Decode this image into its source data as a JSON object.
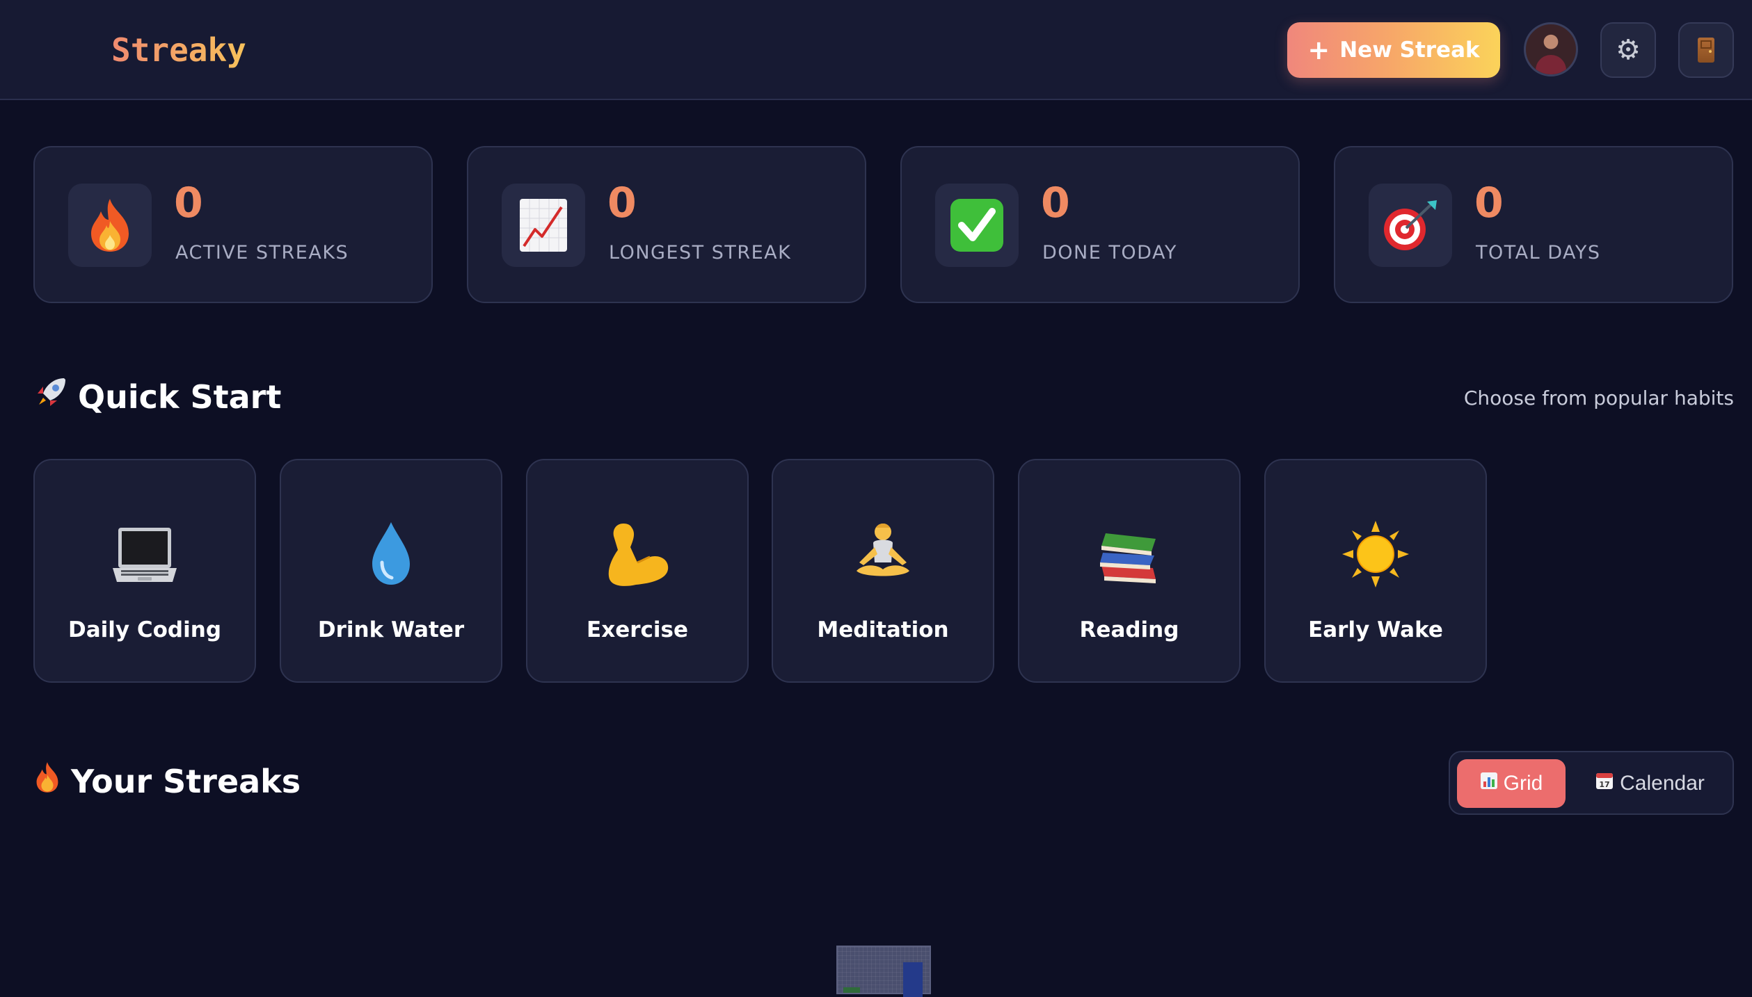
{
  "header": {
    "logo": "Streaky",
    "new_streak_label": "New Streak",
    "new_streak_icon": "plus-icon",
    "settings_icon": "gear-icon",
    "logout_icon": "door-icon"
  },
  "colors": {
    "accent": "#ef8a62",
    "gradient_start": "#f0877c",
    "gradient_end": "#fbd35a",
    "toggle_active": "#ec6d6d",
    "background": "#0d0f24",
    "card": "#1a1d35"
  },
  "stats": [
    {
      "icon": "fire-icon",
      "value": "0",
      "label": "ACTIVE STREAKS"
    },
    {
      "icon": "chart-increasing-icon",
      "value": "0",
      "label": "LONGEST STREAK"
    },
    {
      "icon": "check-mark-icon",
      "value": "0",
      "label": "DONE TODAY"
    },
    {
      "icon": "target-icon",
      "value": "0",
      "label": "TOTAL DAYS"
    }
  ],
  "quick_start": {
    "icon": "rocket-icon",
    "title": "Quick Start",
    "subtitle": "Choose from popular habits",
    "habits": [
      {
        "icon": "laptop-icon",
        "label": "Daily Coding"
      },
      {
        "icon": "droplet-icon",
        "label": "Drink Water"
      },
      {
        "icon": "flexed-biceps-icon",
        "label": "Exercise"
      },
      {
        "icon": "lotus-position-icon",
        "label": "Meditation"
      },
      {
        "icon": "books-icon",
        "label": "Reading"
      },
      {
        "icon": "sun-icon",
        "label": "Early Wake"
      }
    ]
  },
  "streaks": {
    "icon": "fire-icon",
    "title": "Your Streaks",
    "view_toggle": {
      "active": "Grid",
      "grid_label": "Grid",
      "calendar_label": "Calendar"
    }
  }
}
